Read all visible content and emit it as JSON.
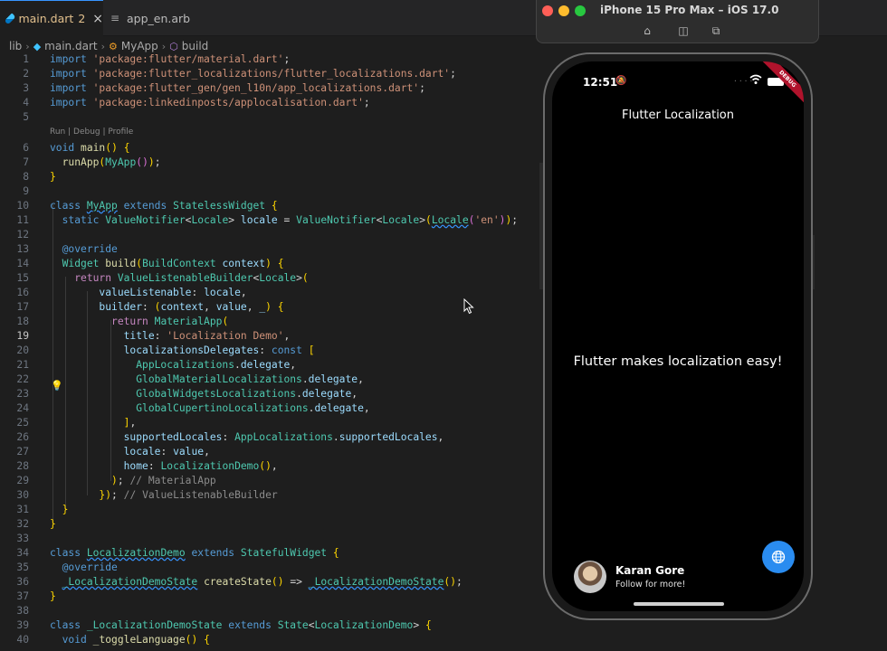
{
  "editor": {
    "tabs": [
      {
        "label": "main.dart",
        "badge": "2",
        "close": "×"
      },
      {
        "label": "app_en.arb"
      }
    ],
    "breadcrumb": [
      "lib",
      "main.dart",
      "MyApp",
      "build"
    ],
    "codelens": "Run | Debug | Profile",
    "active_line": "19",
    "lines": [
      [
        "1",
        "import 'package:flutter/material.dart';"
      ],
      [
        "2",
        "import 'package:flutter_localizations/flutter_localizations.dart';"
      ],
      [
        "3",
        "import 'package:flutter_gen/gen_l10n/app_localizations.dart';"
      ],
      [
        "4",
        "import 'package:linkedinposts/applocalisation.dart';"
      ],
      [
        "5",
        ""
      ],
      [
        "6",
        "void main() {"
      ],
      [
        "7",
        "  runApp(MyApp());"
      ],
      [
        "8",
        "}"
      ],
      [
        "9",
        ""
      ],
      [
        "10",
        "class MyApp extends StatelessWidget {"
      ],
      [
        "11",
        "  static ValueNotifier<Locale> locale = ValueNotifier<Locale>(Locale('en'));"
      ],
      [
        "12",
        ""
      ],
      [
        "13",
        "  @override"
      ],
      [
        "14",
        "  Widget build(BuildContext context) {"
      ],
      [
        "15",
        "    return ValueListenableBuilder<Locale>("
      ],
      [
        "16",
        "        valueListenable: locale,"
      ],
      [
        "17",
        "        builder: (context, value, _) {"
      ],
      [
        "18",
        "          return MaterialApp("
      ],
      [
        "19",
        "            title: 'Localization Demo',"
      ],
      [
        "20",
        "            localizationsDelegates: const ["
      ],
      [
        "21",
        "              AppLocalizations.delegate,"
      ],
      [
        "22",
        "              GlobalMaterialLocalizations.delegate,"
      ],
      [
        "23",
        "              GlobalWidgetsLocalizations.delegate,"
      ],
      [
        "24",
        "              GlobalCupertinoLocalizations.delegate,"
      ],
      [
        "25",
        "            ],"
      ],
      [
        "26",
        "            supportedLocales: AppLocalizations.supportedLocales,"
      ],
      [
        "27",
        "            locale: value,"
      ],
      [
        "28",
        "            home: LocalizationDemo(),"
      ],
      [
        "29",
        "          ); // MaterialApp"
      ],
      [
        "30",
        "        }); // ValueListenableBuilder"
      ],
      [
        "31",
        "  }"
      ],
      [
        "32",
        "}"
      ],
      [
        "33",
        ""
      ],
      [
        "34",
        "class LocalizationDemo extends StatefulWidget {"
      ],
      [
        "35",
        "  @override"
      ],
      [
        "36",
        "  _LocalizationDemoState createState() => _LocalizationDemoState();"
      ],
      [
        "37",
        "}"
      ],
      [
        "38",
        ""
      ],
      [
        "39",
        "class _LocalizationDemoState extends State<LocalizationDemo> {"
      ],
      [
        "40",
        "  void _toggleLanguage() {"
      ]
    ]
  },
  "simulator": {
    "title": "iPhone 15 Pro Max – iOS 17.0",
    "status_time": "12:51",
    "debug_banner": "DEBUG",
    "app_bar_title": "Flutter Localization",
    "body_text": "Flutter makes localization easy!",
    "author_name": "Karan Gore",
    "author_sub": "Follow for more!",
    "fab_icon": "globe-icon"
  },
  "colors": {
    "editor_bg": "#1e1e1e",
    "keyword": "#569cd6",
    "type": "#4ec9b0",
    "string": "#ce9178",
    "fab": "#2a8cf0"
  }
}
